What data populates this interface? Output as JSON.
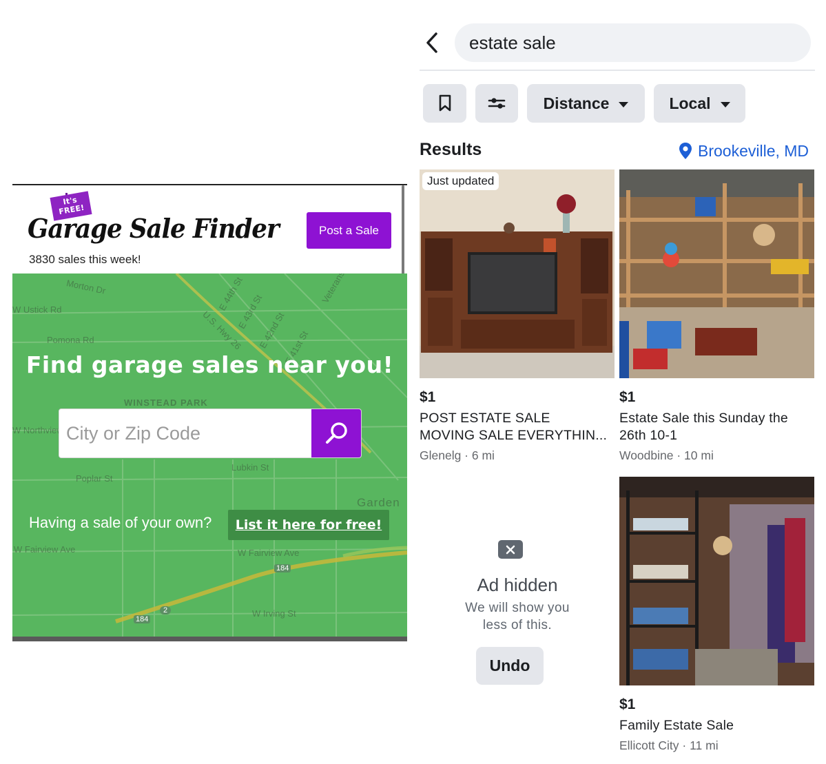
{
  "garage_sale_finder": {
    "badge": {
      "line1": "It's",
      "line2": "FREE!"
    },
    "logo_text": "Garage Sale Finder",
    "sales_count": "3830 sales this week!",
    "post_button": "Post a Sale",
    "hero_title": "Find garage sales near you!",
    "search": {
      "placeholder": "City or Zip Code",
      "value": ""
    },
    "own_sale_text": "Having a sale of your own?",
    "list_link": "List it here for free!",
    "map_labels": {
      "morton": "Morton Dr",
      "ustick": "W Ustick Rd",
      "pomona": "Pomona Rd",
      "hwy": "U.S. Hwy 26",
      "st44": "E 44th St",
      "st43": "E 43rd St",
      "st42": "E 42nd St",
      "st41": "E 41st St",
      "veterans": "Veterans",
      "winstead": "WINSTEAD PARK",
      "northview": "W Northview",
      "poplar": "Poplar St",
      "lubkin": "Lubkin St",
      "garden": "Garden",
      "fairview1": "W Fairview Ave",
      "fairview2": "W Fairview Ave",
      "irving": "W Irving St",
      "shield184": "184",
      "shield184b": "184",
      "shield2": "2"
    }
  },
  "marketplace": {
    "search_query": "estate sale",
    "filters": {
      "distance": "Distance",
      "local": "Local"
    },
    "results_heading": "Results",
    "location": "Brookeville, MD",
    "listings": [
      {
        "badge": "Just updated",
        "price": "$1",
        "title_line1": "POST ESTATE SALE",
        "title_line2": "MOVING SALE EVERYTHIN...",
        "meta": "Glenelg · 6 mi"
      },
      {
        "price": "$1",
        "title_line1": "Estate Sale this Sunday the",
        "title_line2": "26th  10-1",
        "meta": "Woodbine · 10 mi"
      },
      {
        "price": "$1",
        "title_line1": "Family Estate Sale",
        "meta": "Ellicott City · 11 mi"
      }
    ],
    "ad_hidden": {
      "title": "Ad hidden",
      "line1": "We will show you",
      "line2": "less of this.",
      "undo": "Undo"
    }
  },
  "colors": {
    "purple": "#8e12d3",
    "map_green": "#58b65f",
    "fb_blue": "#1d5fd6",
    "chip_gray": "#e4e6eb"
  }
}
